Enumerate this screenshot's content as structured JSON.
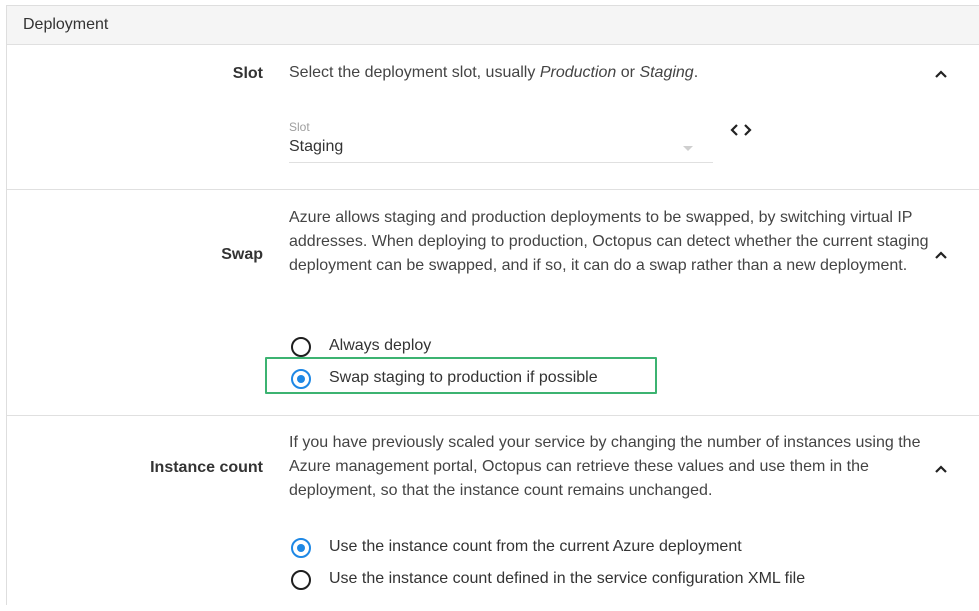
{
  "section": {
    "title": "Deployment"
  },
  "slot": {
    "label": "Slot",
    "desc_prefix": "Select the deployment slot, usually ",
    "desc_em1": "Production",
    "desc_mid": " or ",
    "desc_em2": "Staging",
    "desc_suffix": ".",
    "field_label": "Slot",
    "field_value": "Staging"
  },
  "swap": {
    "label": "Swap",
    "description": "Azure allows staging and production deployments to be swapped, by switching virtual IP addresses. When deploying to production, Octopus can detect whether the current staging deployment can be swapped, and if so, it can do a swap rather than a new deployment.",
    "options": [
      {
        "label": "Always deploy",
        "checked": false
      },
      {
        "label": "Swap staging to production if possible",
        "checked": true
      }
    ]
  },
  "instance_count": {
    "label": "Instance count",
    "description": "If you have previously scaled your service by changing the number of instances using the Azure management portal, Octopus can retrieve these values and use them in the deployment, so that the instance count remains unchanged.",
    "options": [
      {
        "label": "Use the instance count from the current Azure deployment",
        "checked": true
      },
      {
        "label": "Use the instance count defined in the service configuration XML file",
        "checked": false
      }
    ]
  },
  "colors": {
    "accent": "#1e88e5",
    "highlight": "#3cb371"
  }
}
